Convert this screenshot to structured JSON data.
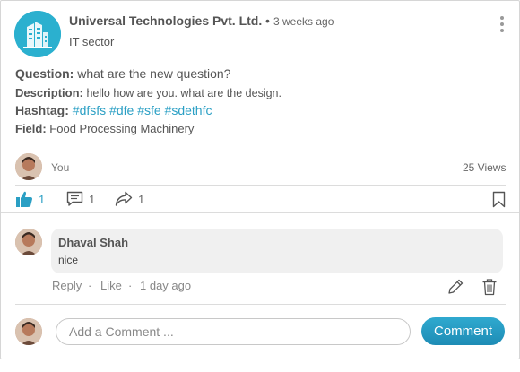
{
  "post": {
    "company": "Universal Technologies Pvt. Ltd.",
    "dot": "•",
    "time": "3 weeks ago",
    "sector": "IT sector",
    "question_label": "Question:",
    "question_value": "what are the new question?",
    "description_label": "Description:",
    "description_value": "hello how are you. what are the design.",
    "hashtag_label": "Hashtag:",
    "hashtags": [
      "#dfsfs",
      "#dfe",
      "#sfe",
      "#sdethfc"
    ],
    "field_label": "Field:",
    "field_value": "Food Processing Machinery",
    "author_label": "You",
    "views": "25 Views"
  },
  "actions": {
    "like_count": "1",
    "comment_count": "1",
    "share_count": "1"
  },
  "comment": {
    "author": "Dhaval Shah",
    "text": "nice",
    "reply_label": "Reply",
    "sep": "·",
    "like_label": "Like",
    "time": "1 day ago"
  },
  "compose": {
    "placeholder": "Add a Comment ...",
    "button_label": "Comment"
  },
  "colors": {
    "accent": "#2a9fc4",
    "button": "#1e8cb5"
  },
  "icons": [
    "company-logo-icon",
    "kebab-menu-icon",
    "like-icon",
    "comment-icon",
    "share-icon",
    "bookmark-icon",
    "edit-icon",
    "delete-icon"
  ]
}
